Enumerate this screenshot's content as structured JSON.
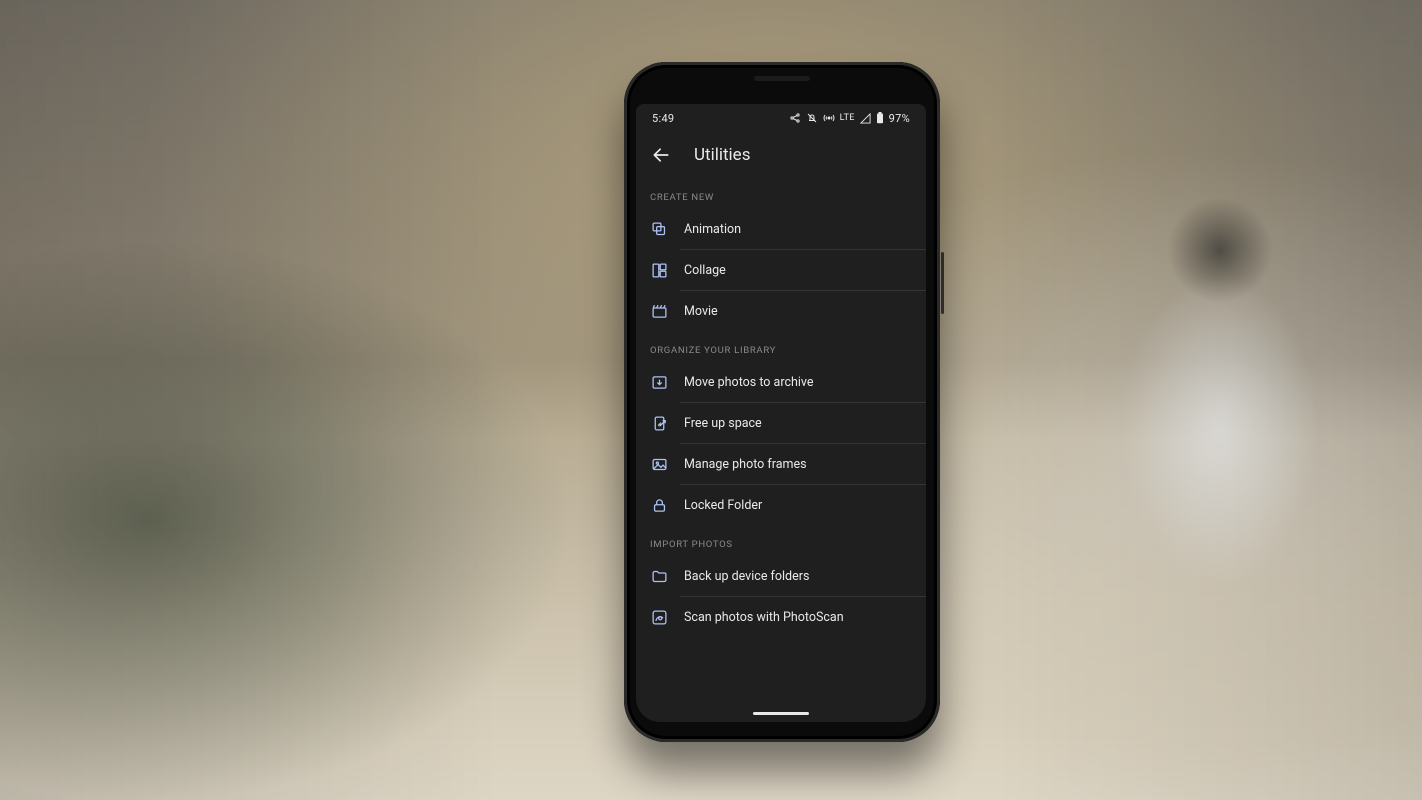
{
  "status_bar": {
    "time": "5:49",
    "network_label": "LTE",
    "battery_text": "97%"
  },
  "app_bar": {
    "title": "Utilities"
  },
  "sections": {
    "create_new": {
      "header": "CREATE NEW",
      "items": [
        {
          "label": "Animation"
        },
        {
          "label": "Collage"
        },
        {
          "label": "Movie"
        }
      ]
    },
    "organize": {
      "header": "ORGANIZE YOUR LIBRARY",
      "items": [
        {
          "label": "Move photos to archive"
        },
        {
          "label": "Free up space"
        },
        {
          "label": "Manage photo frames"
        },
        {
          "label": "Locked Folder"
        }
      ]
    },
    "import": {
      "header": "IMPORT PHOTOS",
      "items": [
        {
          "label": "Back up device folders"
        },
        {
          "label": "Scan photos with PhotoScan"
        }
      ]
    }
  }
}
